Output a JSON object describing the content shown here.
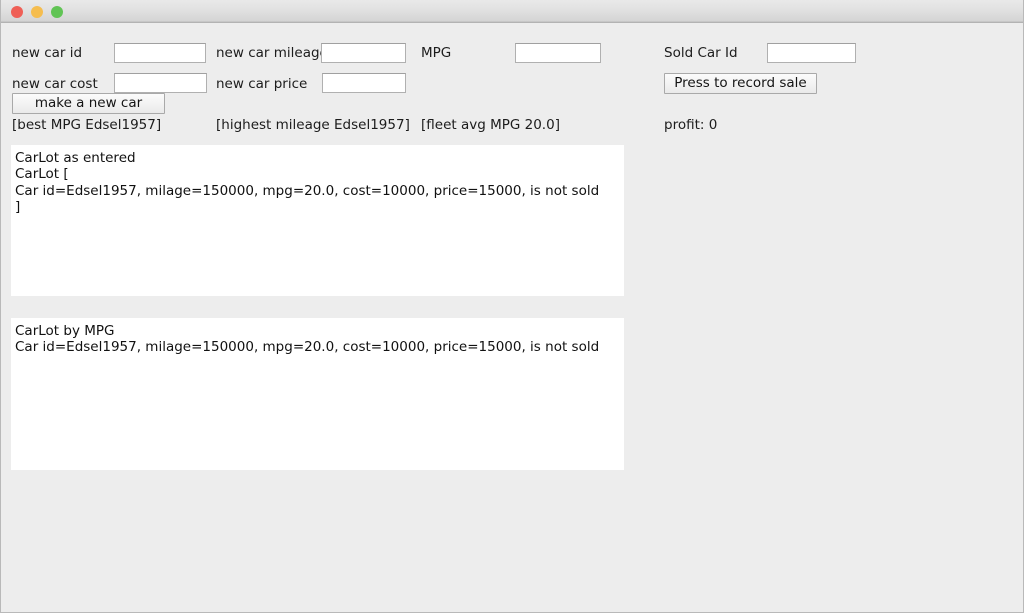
{
  "window": {
    "titlebar": {
      "buttons": [
        {
          "name": "close-button",
          "color": "#ef5f56"
        },
        {
          "name": "minimize-button",
          "color": "#f5bd4f"
        },
        {
          "name": "maximize-button",
          "color": "#61c455"
        }
      ]
    },
    "background_color": "#ededed"
  },
  "form": {
    "new_car_id_label": "new car id",
    "new_car_id_value": "",
    "new_car_mileage_label": "new car mileage",
    "new_car_mileage_value": "",
    "mpg_label": "MPG",
    "mpg_value": "",
    "new_car_cost_label": "new car cost",
    "new_car_cost_value": "",
    "new_car_price_label": "new car price",
    "new_car_price_value": "",
    "make_new_car_button": "make a new car"
  },
  "sale": {
    "sold_car_id_label": "Sold Car Id",
    "sold_car_id_value": "",
    "record_sale_button": "Press to record sale",
    "profit_label": "profit: 0"
  },
  "status": {
    "best_mpg": "[best MPG Edsel1957]",
    "highest_mileage": "[highest mileage Edsel1957]",
    "fleet_avg_mpg": "[fleet avg MPG 20.0]"
  },
  "output": {
    "as_entered_text": "CarLot as entered\nCarLot [\nCar id=Edsel1957, milage=150000, mpg=20.0, cost=10000, price=15000, is not sold\n]",
    "by_mpg_text": "CarLot by MPG\nCar id=Edsel1957, milage=150000, mpg=20.0, cost=10000, price=15000, is not sold"
  }
}
